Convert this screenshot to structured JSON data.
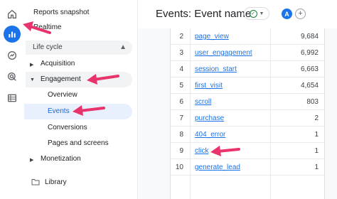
{
  "colors": {
    "accent": "#1a73e8",
    "arrow": "#e8336b",
    "success": "#188038"
  },
  "rail": {
    "icons": [
      "home-icon",
      "bar-chart-icon",
      "explore-icon",
      "target-icon",
      "list-icon"
    ]
  },
  "nav": {
    "reports_snapshot": "Reports snapshot",
    "realtime": "Realtime",
    "life_cycle": "Life cycle",
    "acquisition": "Acquisition",
    "engagement": "Engagement",
    "overview": "Overview",
    "events": "Events",
    "conversions": "Conversions",
    "pages_and_screens": "Pages and screens",
    "monetization": "Monetization",
    "library": "Library"
  },
  "header": {
    "title": "Events: Event name",
    "avatar_letter": "A",
    "add_symbol": "+"
  },
  "table": {
    "rows": [
      {
        "idx": "2",
        "name": "page_view",
        "value": "9,684"
      },
      {
        "idx": "3",
        "name": "user_engagement",
        "value": "6,992"
      },
      {
        "idx": "4",
        "name": "session_start",
        "value": "6,663"
      },
      {
        "idx": "5",
        "name": "first_visit",
        "value": "4,654"
      },
      {
        "idx": "6",
        "name": "scroll",
        "value": "803"
      },
      {
        "idx": "7",
        "name": "purchase",
        "value": "2"
      },
      {
        "idx": "8",
        "name": "404_error",
        "value": "1"
      },
      {
        "idx": "9",
        "name": "click",
        "value": "1"
      },
      {
        "idx": "10",
        "name": "generate_lead",
        "value": "1"
      }
    ]
  }
}
